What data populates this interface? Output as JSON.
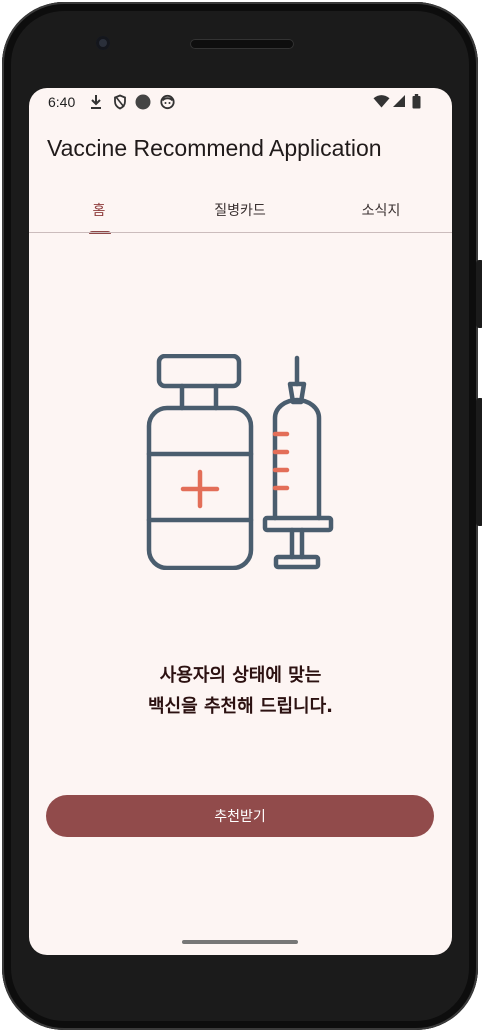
{
  "status_bar": {
    "time": "6:40",
    "left_icons": [
      "download-icon",
      "shield-icon",
      "circle-icon",
      "face-icon"
    ],
    "right_icons": [
      "wifi-icon",
      "signal-icon",
      "battery-icon"
    ]
  },
  "app_bar": {
    "title": "Vaccine Recommend Application"
  },
  "tabs": [
    {
      "label": "홈",
      "active": true
    },
    {
      "label": "질병카드",
      "active": false
    },
    {
      "label": "소식지",
      "active": false
    }
  ],
  "main": {
    "illustration": "vaccine-and-syringe-icon",
    "message_line1": "사용자의 상태에 맞는",
    "message_line2": "백신을 추천해 드립니다.",
    "button_label": "추천받기"
  },
  "colors": {
    "background": "#fdf5f3",
    "primary": "#914b4b",
    "illustration_stroke": "#4a5d6e",
    "illustration_accent": "#e36e58"
  }
}
